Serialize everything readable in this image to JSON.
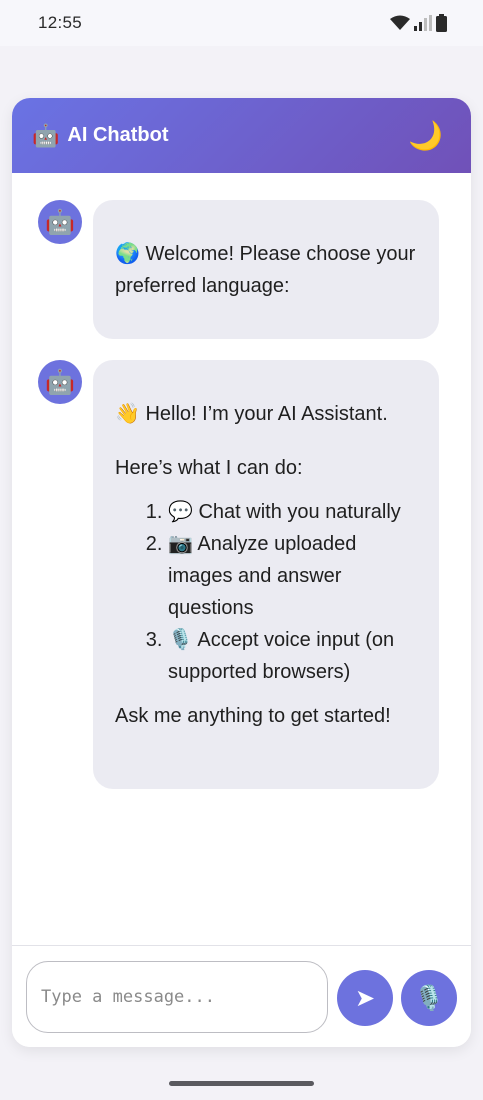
{
  "status_bar": {
    "time": "12:55",
    "icons": [
      "wifi-icon",
      "signal-icon",
      "battery-icon"
    ]
  },
  "header": {
    "icon": "🤖",
    "title": "AI Chatbot",
    "theme_icon": "🌙"
  },
  "messages": [
    {
      "sender_avatar": "🤖",
      "text": "🌍 Welcome! Please choose your preferred language:"
    },
    {
      "sender_avatar": "🤖",
      "greeting": "👋 Hello! I’m your AI Assistant.",
      "intro": "Here’s what I can do:",
      "features": [
        "💬 Chat with you naturally",
        "📷 Analyze uploaded images and answer questions",
        "🎙️ Accept voice input (on supported browsers)"
      ],
      "closing": "Ask me anything to get started!"
    }
  ],
  "composer": {
    "placeholder": "Type a message...",
    "value": "",
    "send_icon": "➤",
    "mic_icon": "🎙️"
  },
  "colors": {
    "accent": "#6d72de",
    "header_start": "#6a73e4",
    "header_end": "#7051b8",
    "bubble": "#ebebf2"
  }
}
